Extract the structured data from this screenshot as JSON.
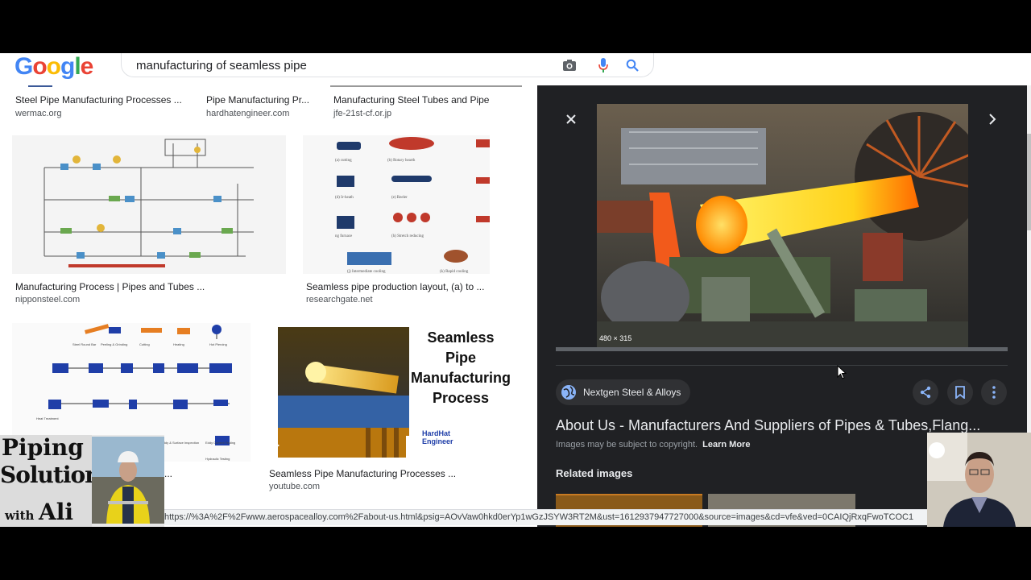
{
  "search": {
    "query": "manufacturing of seamless pipe"
  },
  "logo": {
    "letters": [
      "G",
      "o",
      "o",
      "g",
      "l",
      "e"
    ],
    "colors": [
      "#4285f4",
      "#ea4335",
      "#fbbc05",
      "#4285f4",
      "#34a853",
      "#ea4335"
    ]
  },
  "results": [
    {
      "title": "Steel Pipe Manufacturing Processes ...",
      "source": "wermac.org"
    },
    {
      "title": "Pipe Manufacturing Pr...",
      "source": "hardhatengineer.com"
    },
    {
      "title": "Manufacturing Steel Tubes and Pipe",
      "source": "jfe-21st-cf.or.jp"
    },
    {
      "title": "Manufacturing Process | Pipes and Tubes ...",
      "source": "nipponsteel.com"
    },
    {
      "title": "Seamless pipe production layout, (a) to ...",
      "source": "researchgate.net"
    },
    {
      "title": "...",
      "source": ""
    },
    {
      "title": "Seamless Pipe Manufacturing Processes ...",
      "source": "youtube.com"
    }
  ],
  "thumb_text": {
    "hardhat_title": "Seamless Pipe Manufacturing Process",
    "hardhat_brand": "HardHat Engineer"
  },
  "panel": {
    "dimensions": "480 × 315",
    "source_chip": "Nextgen Steel & Alloys",
    "title": "About Us - Manufacturers And Suppliers of Pipes & Tubes,Flang...",
    "copyright": "Images may be subject to copyright.",
    "learn_more": "Learn More",
    "related": "Related images"
  },
  "overlay": {
    "brand_line1": "Piping",
    "brand_line2": "Solutions",
    "brand_with": "with",
    "brand_name": "Ali"
  },
  "status_url": "https://%3A%2F%2Fwww.aerospacealloy.com%2Fabout-us.html&psig=AOvVaw0hkd0erYp1wGzJSYW3RT2M&ust=1612937947727000&source=images&cd=vfe&ved=0CAIQjRxqFwoTCOC1"
}
